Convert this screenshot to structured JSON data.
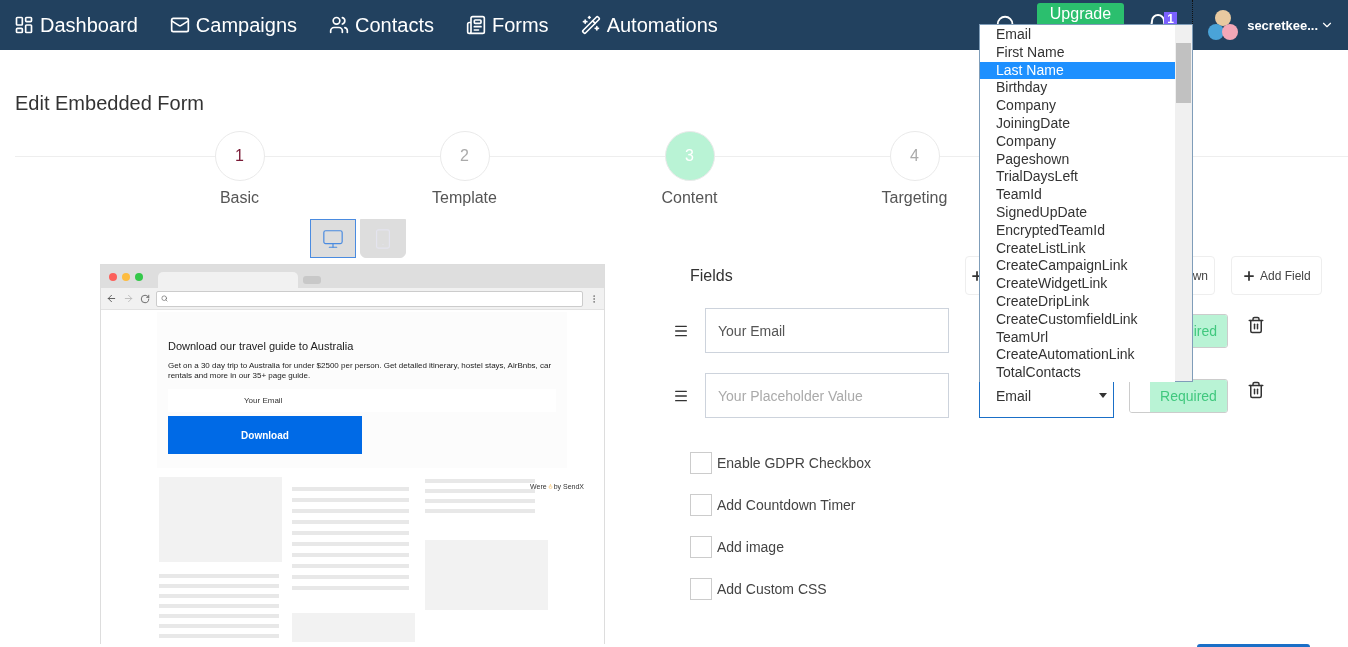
{
  "nav": {
    "items": [
      {
        "label": "Dashboard"
      },
      {
        "label": "Campaigns"
      },
      {
        "label": "Contacts"
      },
      {
        "label": "Forms"
      },
      {
        "label": "Automations"
      }
    ],
    "upgrade": "Upgrade",
    "notifications": "1",
    "user": "secretkee..."
  },
  "page_title": "Edit Embedded Form",
  "steps": [
    {
      "number": "1",
      "label": "Basic",
      "selected": false,
      "completed": true
    },
    {
      "number": "2",
      "label": "Template",
      "selected": false,
      "completed": false
    },
    {
      "number": "3",
      "label": "Content",
      "selected": true,
      "completed": false
    },
    {
      "number": "4",
      "label": "Targeting",
      "selected": false,
      "completed": false
    }
  ],
  "devices": [
    {
      "kind": "desktop",
      "selected": true
    },
    {
      "kind": "mobile",
      "selected": false
    }
  ],
  "preview": {
    "heading": "Download our travel guide to Australia",
    "text": "Get on a 30 day trip to Australia for under $2500 per person. Get detailed itinerary, hostel stays, AirBnbs, car rentals and more in our 35+ page guide.",
    "email_placeholder": "Your Email",
    "button": "Download",
    "credit_before": "Were",
    "credit_after": "by SendX"
  },
  "fields_panel": {
    "title": "Fields",
    "covered_button": "wn",
    "add_field": "Add Field",
    "rows": [
      {
        "value": "Your Email",
        "placeholder": "",
        "type": "",
        "required_text": "ired",
        "required": true
      },
      {
        "value": "",
        "placeholder": "Your Placeholder Value",
        "type": "Email",
        "required_text": "Required",
        "required": true
      }
    ],
    "options": [
      {
        "label": "Enable GDPR Checkbox",
        "checked": false
      },
      {
        "label": "Add Countdown Timer",
        "checked": false
      },
      {
        "label": "Add image",
        "checked": false
      },
      {
        "label": "Add Custom CSS",
        "checked": false
      }
    ]
  },
  "open_dropdown": {
    "options": [
      {
        "label": "Email",
        "selected": false
      },
      {
        "label": "First Name",
        "selected": false
      },
      {
        "label": "Last Name",
        "selected": true
      },
      {
        "label": "Birthday",
        "selected": false
      },
      {
        "label": "Company",
        "selected": false
      },
      {
        "label": "JoiningDate",
        "selected": false
      },
      {
        "label": "Company",
        "selected": false
      },
      {
        "label": "Pageshown",
        "selected": false
      },
      {
        "label": "TrialDaysLeft",
        "selected": false
      },
      {
        "label": "TeamId",
        "selected": false
      },
      {
        "label": "SignedUpDate",
        "selected": false
      },
      {
        "label": "EncryptedTeamId",
        "selected": false
      },
      {
        "label": "CreateListLink",
        "selected": false
      },
      {
        "label": "CreateCampaignLink",
        "selected": false
      },
      {
        "label": "CreateWidgetLink",
        "selected": false
      },
      {
        "label": "CreateDripLink",
        "selected": false
      },
      {
        "label": "CreateCustomfieldLink",
        "selected": false
      },
      {
        "label": "TeamUrl",
        "selected": false
      },
      {
        "label": "CreateAutomationLink",
        "selected": false
      },
      {
        "label": "TotalContacts",
        "selected": false
      }
    ]
  }
}
